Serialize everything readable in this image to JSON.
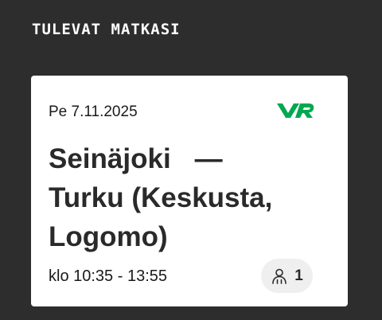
{
  "section": {
    "title": "TULEVAT MATKASI"
  },
  "trip": {
    "date": "Pe 7.11.2025",
    "brand": "VR",
    "brand_color": "#00a84f",
    "origin": "Seinäjoki",
    "separator": "—",
    "destination_line1": "Turku (Keskusta,",
    "destination_line2": "Logomo)",
    "time": "klo 10:35 - 13:55",
    "passenger_icon": "passenger-icon",
    "passenger_count": "1"
  }
}
